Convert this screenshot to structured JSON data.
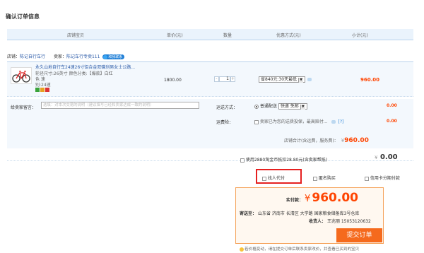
{
  "page_title": "确认订单信息",
  "columns": {
    "store_item": "店铺宝贝",
    "unit_price": "单价(元)",
    "quantity": "数量",
    "discount": "优惠方式(元)",
    "subtotal": "小计(元)"
  },
  "shop": {
    "shop_label": "店铺：",
    "shop_name": "陈记自行车行",
    "seller_label": "卖家：",
    "seller_name": "陈记车行专卖111",
    "contact_label": "和我联系"
  },
  "item": {
    "name": "永久山地自行车24速26寸铝合金双碟刹男女士公路...",
    "attr_line1": "轮径尺寸:26英寸 颜色分类:【爆款】白红色 速",
    "attr_line2": "别:24速",
    "unit_price": "1800.00",
    "quantity": "1",
    "qty_minus": "-",
    "qty_plus": "+",
    "discount_option": "省840元:30天最低",
    "subtotal": "960.00"
  },
  "memo": {
    "label": "给卖家留言：",
    "placeholder": "选填：对本次交易的说明（建议填写已经和卖家达成一致的说明）"
  },
  "shipping": {
    "label": "运送方式：",
    "option_label": "普通配送",
    "select_value": "快递 免邮",
    "fee": "0.00"
  },
  "insurance": {
    "label": "运费险：",
    "text": "卖家已为您的送质投保，最高赔付...",
    "help": "[?]",
    "fee": "0.00"
  },
  "store_total": {
    "label": "店铺合计(含运费，服务费)：",
    "currency": "¥",
    "amount": "960.00"
  },
  "coin": {
    "text": "使用2880淘金币抵扣28.80元(含卖家帮抵)",
    "currency": "¥",
    "amount": "0.00"
  },
  "options": {
    "proxy_pay": "找人代付",
    "anonymous": "匿名购买",
    "credit_card": "信用卡分期付款"
  },
  "payment": {
    "label": "实付款：",
    "currency": "¥",
    "amount": "960.00",
    "address_label": "寄送至：",
    "address": "山东省 济南市 长清区 大学路 国家粮食储备库3号仓库",
    "receiver_label": "收货人：",
    "receiver": "王兆丽 15053120632",
    "submit": "提交订单"
  },
  "tip": "若价格变动，请在提交订单后联系卖家改价，并查看已买到的宝贝",
  "colors": {
    "accent_orange": "#f56a1d",
    "price_red": "#ff4400",
    "highlight_red": "#e52020",
    "header_blue": "#eaf3fc",
    "link_blue": "#2a5aa8"
  }
}
